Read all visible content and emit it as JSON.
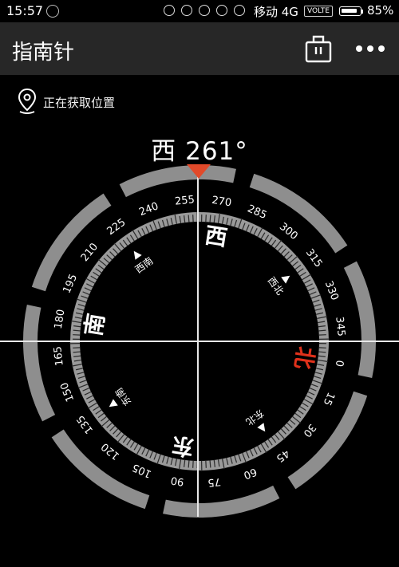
{
  "status_bar": {
    "time": "15:57",
    "carrier": "移动 4G",
    "volte": "VOLTE",
    "battery": "85%",
    "battery_level": 0.85
  },
  "app_bar": {
    "title": "指南针",
    "calibrate_icon": "toolbox-icon",
    "more_icon": "more-dots-icon"
  },
  "location": {
    "icon": "location-pin-icon",
    "text": "正在获取位置"
  },
  "heading": {
    "direction": "西",
    "degrees": "261°",
    "value": 261
  },
  "dial": {
    "degree_labels": [
      "15",
      "30",
      "45",
      "60",
      "75",
      "90",
      "105",
      "120",
      "135",
      "150",
      "165",
      "180",
      "195",
      "210",
      "225",
      "240",
      "255",
      "270",
      "285",
      "300",
      "315",
      "330",
      "345",
      "0"
    ],
    "cardinals": {
      "north": "北",
      "east": "东",
      "south": "南",
      "west": "西"
    },
    "intercardinals": {
      "northeast": "东北",
      "southeast": "东南",
      "southwest": "西南",
      "northwest": "西北"
    },
    "colors": {
      "north": "#e0311b",
      "pointer": "#e24a2a",
      "ring": "#8e8e8e",
      "dial_text": "#ffffff"
    }
  }
}
